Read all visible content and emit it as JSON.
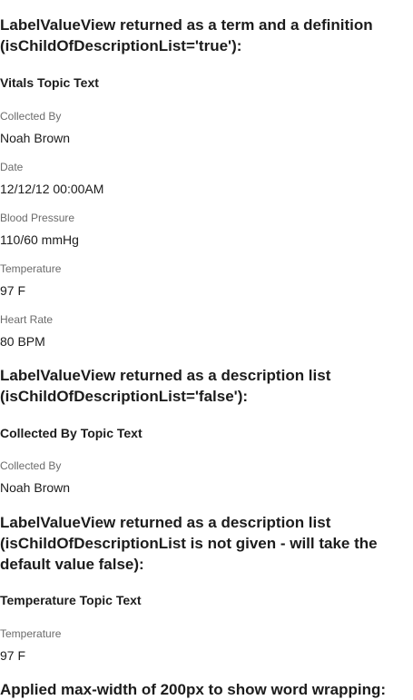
{
  "sections": [
    {
      "heading": "LabelValueView returned as a term and a definition (isChildOfDescriptionList='true'):",
      "topic": "Vitals Topic Text",
      "items": [
        {
          "term": "Collected By",
          "value": "Noah Brown"
        },
        {
          "term": "Date",
          "value": "12/12/12 00:00AM"
        },
        {
          "term": "Blood Pressure",
          "value": "110/60 mmHg"
        },
        {
          "term": "Temperature",
          "value": "97 F"
        },
        {
          "term": "Heart Rate",
          "value": "80 BPM"
        }
      ]
    },
    {
      "heading": "LabelValueView returned as a description list (isChildOfDescriptionList='false'):",
      "topic": "Collected By Topic Text",
      "items": [
        {
          "term": "Collected By",
          "value": "Noah Brown"
        }
      ]
    },
    {
      "heading": "LabelValueView returned as a description list (isChildOfDescriptionList is not given - will take the default value false):",
      "topic": "Temperature Topic Text",
      "items": [
        {
          "term": "Temperature",
          "value": "97 F"
        }
      ]
    },
    {
      "heading": "Applied max-width of 200px to show word wrapping:"
    }
  ]
}
